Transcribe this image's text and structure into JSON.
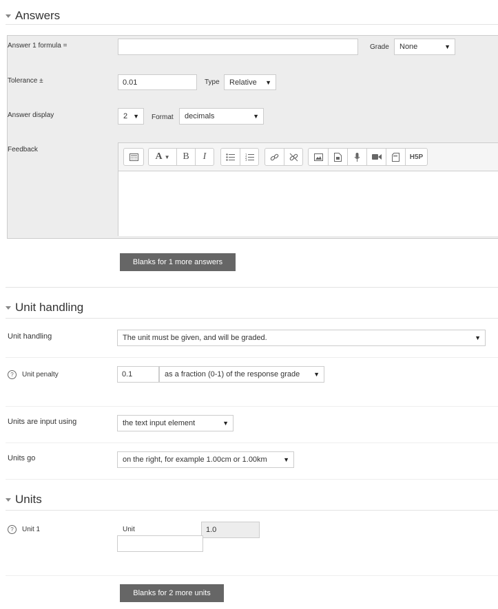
{
  "answers": {
    "title": "Answers",
    "answer_formula_label": "Answer 1 formula =",
    "answer_formula_value": "",
    "grade_label": "Grade",
    "grade_value": "None",
    "tolerance_label": "Tolerance ±",
    "tolerance_value": "0.01",
    "type_label": "Type",
    "type_value": "Relative",
    "answer_display_label": "Answer display",
    "answer_display_value": "2",
    "format_label": "Format",
    "format_value": "decimals",
    "feedback_label": "Feedback",
    "toolbar_icons": [
      "toolbar-toggle-icon",
      "font-color-icon",
      "bold-icon",
      "italic-icon",
      "bullet-list-icon",
      "numbered-list-icon",
      "link-icon",
      "unlink-icon",
      "image-icon",
      "media-icon",
      "record-audio-icon",
      "record-video-icon",
      "manage-files-icon",
      "h5p-icon"
    ],
    "h5p_text": "H5P",
    "blanks_button": "Blanks for 1 more answers"
  },
  "unit_handling": {
    "title": "Unit handling",
    "handling_label": "Unit handling",
    "handling_value": "The unit must be given, and will be graded.",
    "penalty_label": "Unit penalty",
    "penalty_value": "0.1",
    "penalty_mode": "as a fraction (0-1) of the response grade",
    "input_label": "Units are input using",
    "input_value": "the text input element",
    "go_label": "Units go",
    "go_value": "on the right, for example 1.00cm or 1.00km"
  },
  "units": {
    "title": "Units",
    "unit1_label": "Unit 1",
    "unit_field_label": "Unit",
    "multiplier_value": "1.0",
    "unit_value": "",
    "blanks_button": "Blanks for 2 more units"
  }
}
